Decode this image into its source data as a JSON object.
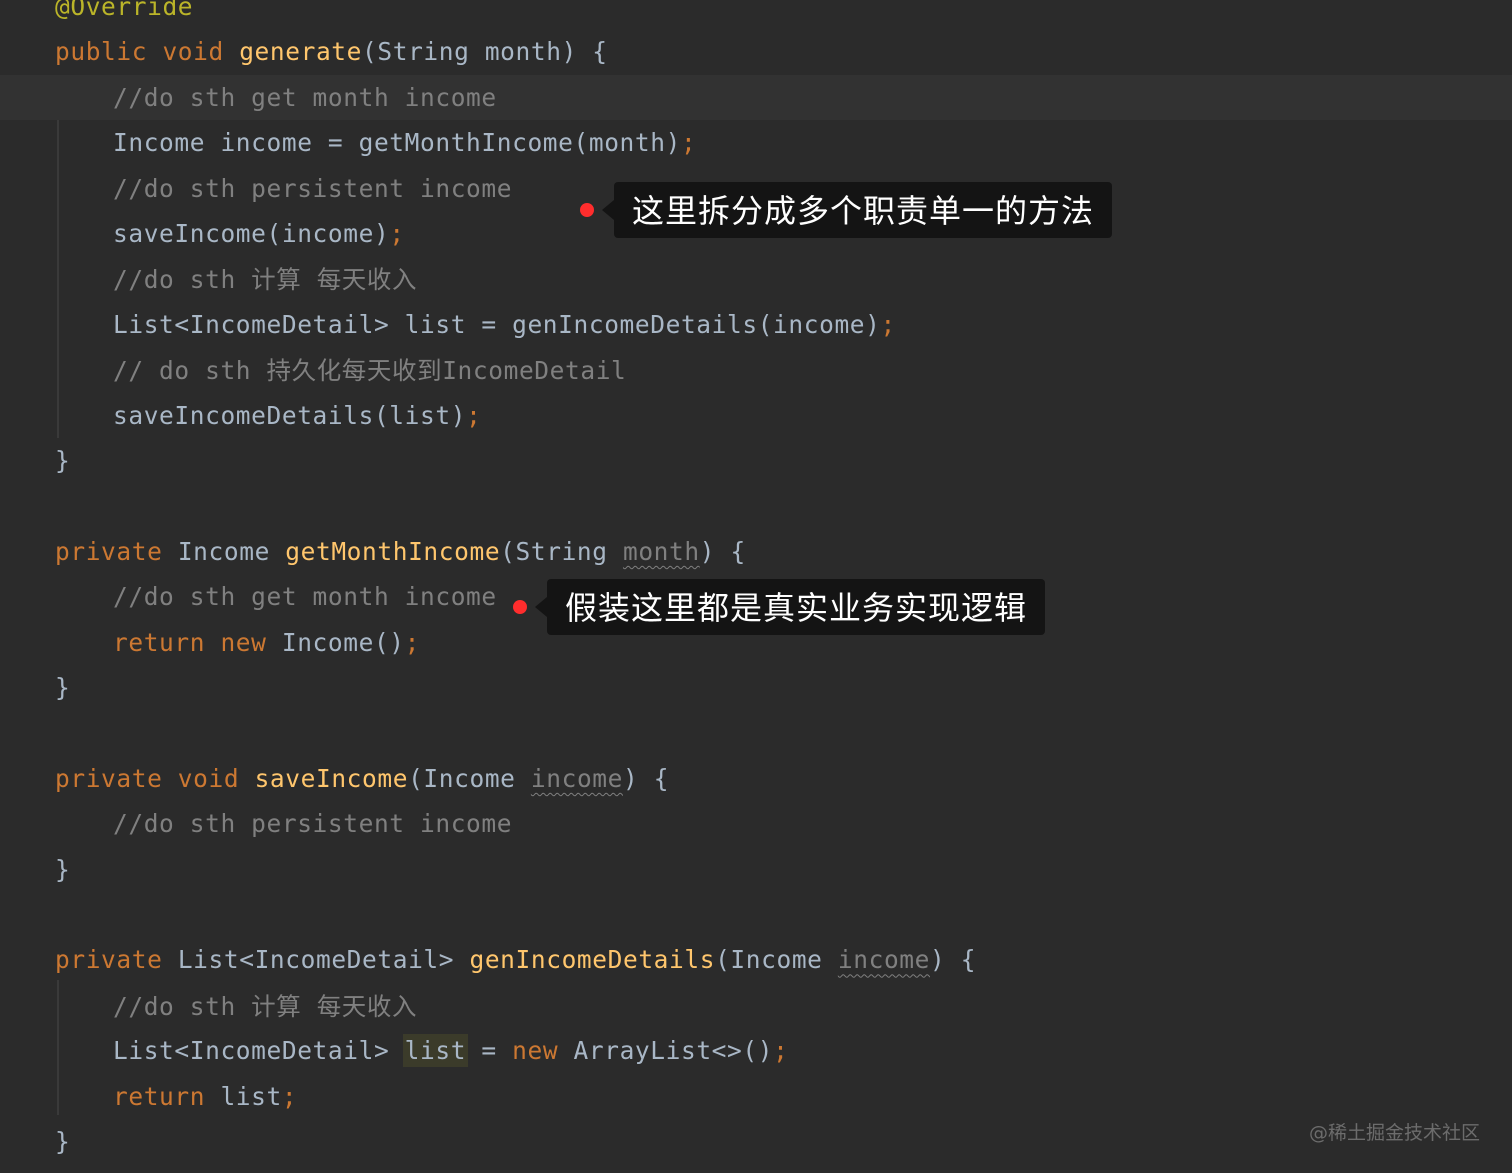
{
  "code_lines": [
    {
      "tokens": [
        [
          "t-ann",
          "@Override"
        ]
      ]
    },
    {
      "tokens": [
        [
          "t-kw",
          "public void "
        ],
        [
          "t-fn",
          "generate"
        ],
        [
          "t-plain",
          "(String month) {"
        ]
      ]
    },
    {
      "indent": 1,
      "current": true,
      "tokens": [
        [
          "t-comment",
          "//do sth get month income"
        ]
      ]
    },
    {
      "indent": 1,
      "tokens": [
        [
          "t-plain",
          "Income income = getMonthIncome(month)"
        ],
        [
          "t-kw",
          ";"
        ]
      ]
    },
    {
      "indent": 1,
      "tokens": [
        [
          "t-comment",
          "//do sth persistent income"
        ]
      ]
    },
    {
      "indent": 1,
      "tokens": [
        [
          "t-plain",
          "saveIncome(income)"
        ],
        [
          "t-kw",
          ";"
        ]
      ]
    },
    {
      "indent": 1,
      "tokens": [
        [
          "t-comment",
          "//do sth 计算 每天收入"
        ]
      ]
    },
    {
      "indent": 1,
      "tokens": [
        [
          "t-plain",
          "List<IncomeDetail> list = genIncomeDetails(income)"
        ],
        [
          "t-kw",
          ";"
        ]
      ]
    },
    {
      "indent": 1,
      "tokens": [
        [
          "t-comment",
          "// do sth 持久化每天收到IncomeDetail"
        ]
      ]
    },
    {
      "indent": 1,
      "tokens": [
        [
          "t-plain",
          "saveIncomeDetails(list)"
        ],
        [
          "t-kw",
          ";"
        ]
      ]
    },
    {
      "tokens": [
        [
          "t-plain",
          "}"
        ]
      ]
    },
    {
      "tokens": []
    },
    {
      "tokens": [
        [
          "t-kw",
          "private "
        ],
        [
          "t-plain",
          "Income "
        ],
        [
          "t-fn",
          "getMonthIncome"
        ],
        [
          "t-plain",
          "(String "
        ],
        [
          "t-param-unused",
          "month"
        ],
        [
          "t-plain",
          ") {"
        ]
      ]
    },
    {
      "indent": 1,
      "tokens": [
        [
          "t-comment",
          "//do sth get month income"
        ]
      ]
    },
    {
      "indent": 1,
      "tokens": [
        [
          "t-kw",
          "return new "
        ],
        [
          "t-plain",
          "Income()"
        ],
        [
          "t-kw",
          ";"
        ]
      ]
    },
    {
      "tokens": [
        [
          "t-plain",
          "}"
        ]
      ]
    },
    {
      "tokens": []
    },
    {
      "tokens": [
        [
          "t-kw",
          "private void "
        ],
        [
          "t-fn",
          "saveIncome"
        ],
        [
          "t-plain",
          "(Income "
        ],
        [
          "t-param-unused",
          "income"
        ],
        [
          "t-plain",
          ") {"
        ]
      ]
    },
    {
      "indent": 1,
      "tokens": [
        [
          "t-comment",
          "//do sth persistent income"
        ]
      ]
    },
    {
      "tokens": [
        [
          "t-plain",
          "}"
        ]
      ]
    },
    {
      "tokens": []
    },
    {
      "tokens": [
        [
          "t-kw",
          "private "
        ],
        [
          "t-plain",
          "List<IncomeDetail> "
        ],
        [
          "t-fn",
          "genIncomeDetails"
        ],
        [
          "t-plain",
          "(Income "
        ],
        [
          "t-param-unused",
          "income"
        ],
        [
          "t-plain",
          ") {"
        ]
      ]
    },
    {
      "indent": 1,
      "tokens": [
        [
          "t-comment",
          "//do sth 计算 每天收入"
        ]
      ]
    },
    {
      "indent": 1,
      "tokens": [
        [
          "t-plain",
          "List<IncomeDetail> "
        ],
        [
          "t-highlight",
          "list"
        ],
        [
          "t-plain",
          " = "
        ],
        [
          "t-kw",
          "new "
        ],
        [
          "t-plain",
          "ArrayList<>()"
        ],
        [
          "t-kw",
          ";"
        ]
      ]
    },
    {
      "indent": 1,
      "tokens": [
        [
          "t-kw",
          "return "
        ],
        [
          "t-plain",
          "list"
        ],
        [
          "t-kw",
          ";"
        ]
      ]
    },
    {
      "tokens": [
        [
          "t-plain",
          "}"
        ]
      ]
    }
  ],
  "callouts": [
    {
      "text": "这里拆分成多个职责单一的方法"
    },
    {
      "text": "假装这里都是真实业务实现逻辑"
    }
  ],
  "watermark": "@稀土掘金技术社区",
  "colors": {
    "background": "#2b2b2b",
    "keyword": "#cc7832",
    "function": "#ffc66d",
    "plain": "#a9b7c6",
    "comment": "#808080",
    "annotation": "#bbb529",
    "callout_dot": "#ff2d2d"
  }
}
